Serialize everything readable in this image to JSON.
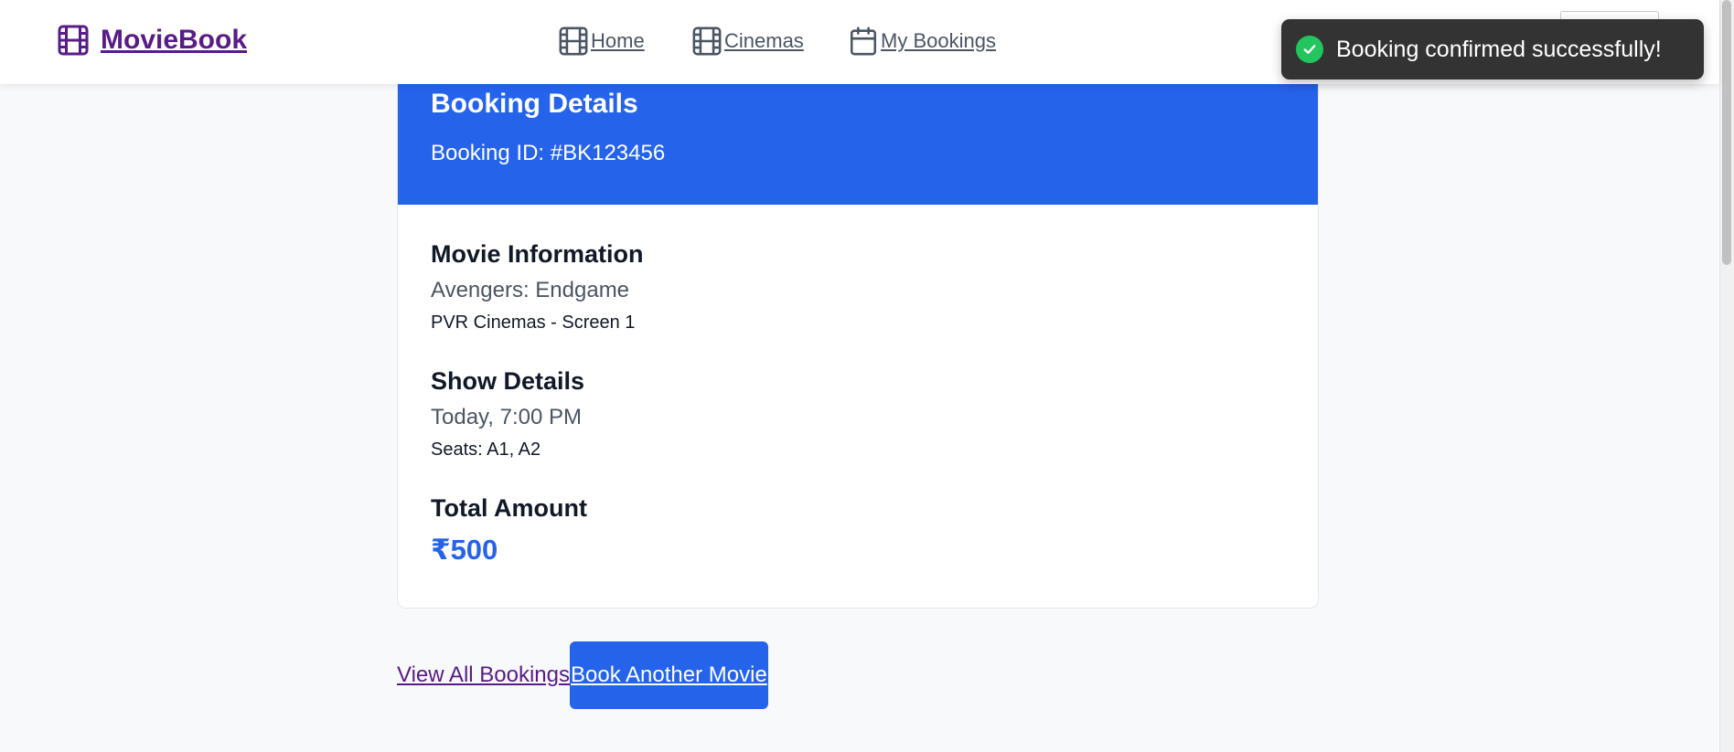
{
  "navbar": {
    "brand": "MovieBook",
    "links": [
      {
        "label": "Home",
        "icon": "film-icon"
      },
      {
        "label": "Cinemas",
        "icon": "film-icon"
      },
      {
        "label": "My Bookings",
        "icon": "calendar-icon"
      }
    ]
  },
  "toast": {
    "message": "Booking confirmed successfully!",
    "icon": "check-circle-icon",
    "color": "#22c55e"
  },
  "booking": {
    "title": "Booking Details",
    "booking_id": "Booking ID: #BK123456",
    "movie": {
      "heading": "Movie Information",
      "name": "Avengers: Endgame",
      "venue": "PVR Cinemas - Screen 1"
    },
    "show": {
      "heading": "Show Details",
      "time": "Today, 7:00 PM",
      "seats": "Seats: A1, A2"
    },
    "total": {
      "heading": "Total Amount",
      "amount": "₹500"
    }
  },
  "actions": {
    "view_all": "View All Bookings",
    "book_another": "Book Another Movie"
  },
  "colors": {
    "brand": "#581c87",
    "primary": "#2563eb",
    "toast_bg": "#333333"
  }
}
